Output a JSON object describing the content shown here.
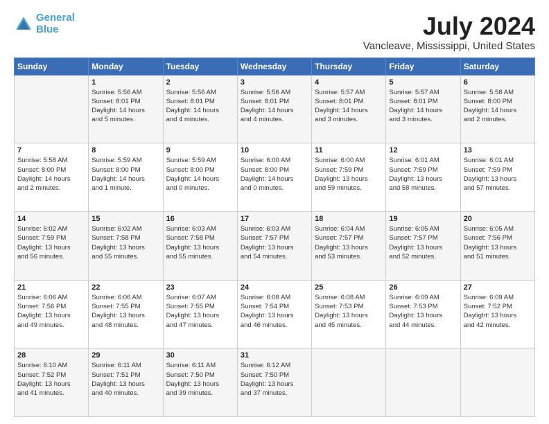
{
  "logo": {
    "line1": "General",
    "line2": "Blue"
  },
  "title": "July 2024",
  "subtitle": "Vancleave, Mississippi, United States",
  "days_of_week": [
    "Sunday",
    "Monday",
    "Tuesday",
    "Wednesday",
    "Thursday",
    "Friday",
    "Saturday"
  ],
  "weeks": [
    [
      {
        "day": "",
        "info": ""
      },
      {
        "day": "1",
        "info": "Sunrise: 5:56 AM\nSunset: 8:01 PM\nDaylight: 14 hours\nand 5 minutes."
      },
      {
        "day": "2",
        "info": "Sunrise: 5:56 AM\nSunset: 8:01 PM\nDaylight: 14 hours\nand 4 minutes."
      },
      {
        "day": "3",
        "info": "Sunrise: 5:56 AM\nSunset: 8:01 PM\nDaylight: 14 hours\nand 4 minutes."
      },
      {
        "day": "4",
        "info": "Sunrise: 5:57 AM\nSunset: 8:01 PM\nDaylight: 14 hours\nand 3 minutes."
      },
      {
        "day": "5",
        "info": "Sunrise: 5:57 AM\nSunset: 8:01 PM\nDaylight: 14 hours\nand 3 minutes."
      },
      {
        "day": "6",
        "info": "Sunrise: 5:58 AM\nSunset: 8:00 PM\nDaylight: 14 hours\nand 2 minutes."
      }
    ],
    [
      {
        "day": "7",
        "info": "Sunrise: 5:58 AM\nSunset: 8:00 PM\nDaylight: 14 hours\nand 2 minutes."
      },
      {
        "day": "8",
        "info": "Sunrise: 5:59 AM\nSunset: 8:00 PM\nDaylight: 14 hours\nand 1 minute."
      },
      {
        "day": "9",
        "info": "Sunrise: 5:59 AM\nSunset: 8:00 PM\nDaylight: 14 hours\nand 0 minutes."
      },
      {
        "day": "10",
        "info": "Sunrise: 6:00 AM\nSunset: 8:00 PM\nDaylight: 14 hours\nand 0 minutes."
      },
      {
        "day": "11",
        "info": "Sunrise: 6:00 AM\nSunset: 7:59 PM\nDaylight: 13 hours\nand 59 minutes."
      },
      {
        "day": "12",
        "info": "Sunrise: 6:01 AM\nSunset: 7:59 PM\nDaylight: 13 hours\nand 58 minutes."
      },
      {
        "day": "13",
        "info": "Sunrise: 6:01 AM\nSunset: 7:59 PM\nDaylight: 13 hours\nand 57 minutes."
      }
    ],
    [
      {
        "day": "14",
        "info": "Sunrise: 6:02 AM\nSunset: 7:59 PM\nDaylight: 13 hours\nand 56 minutes."
      },
      {
        "day": "15",
        "info": "Sunrise: 6:02 AM\nSunset: 7:58 PM\nDaylight: 13 hours\nand 55 minutes."
      },
      {
        "day": "16",
        "info": "Sunrise: 6:03 AM\nSunset: 7:58 PM\nDaylight: 13 hours\nand 55 minutes."
      },
      {
        "day": "17",
        "info": "Sunrise: 6:03 AM\nSunset: 7:57 PM\nDaylight: 13 hours\nand 54 minutes."
      },
      {
        "day": "18",
        "info": "Sunrise: 6:04 AM\nSunset: 7:57 PM\nDaylight: 13 hours\nand 53 minutes."
      },
      {
        "day": "19",
        "info": "Sunrise: 6:05 AM\nSunset: 7:57 PM\nDaylight: 13 hours\nand 52 minutes."
      },
      {
        "day": "20",
        "info": "Sunrise: 6:05 AM\nSunset: 7:56 PM\nDaylight: 13 hours\nand 51 minutes."
      }
    ],
    [
      {
        "day": "21",
        "info": "Sunrise: 6:06 AM\nSunset: 7:56 PM\nDaylight: 13 hours\nand 49 minutes."
      },
      {
        "day": "22",
        "info": "Sunrise: 6:06 AM\nSunset: 7:55 PM\nDaylight: 13 hours\nand 48 minutes."
      },
      {
        "day": "23",
        "info": "Sunrise: 6:07 AM\nSunset: 7:55 PM\nDaylight: 13 hours\nand 47 minutes."
      },
      {
        "day": "24",
        "info": "Sunrise: 6:08 AM\nSunset: 7:54 PM\nDaylight: 13 hours\nand 46 minutes."
      },
      {
        "day": "25",
        "info": "Sunrise: 6:08 AM\nSunset: 7:53 PM\nDaylight: 13 hours\nand 45 minutes."
      },
      {
        "day": "26",
        "info": "Sunrise: 6:09 AM\nSunset: 7:53 PM\nDaylight: 13 hours\nand 44 minutes."
      },
      {
        "day": "27",
        "info": "Sunrise: 6:09 AM\nSunset: 7:52 PM\nDaylight: 13 hours\nand 42 minutes."
      }
    ],
    [
      {
        "day": "28",
        "info": "Sunrise: 6:10 AM\nSunset: 7:52 PM\nDaylight: 13 hours\nand 41 minutes."
      },
      {
        "day": "29",
        "info": "Sunrise: 6:11 AM\nSunset: 7:51 PM\nDaylight: 13 hours\nand 40 minutes."
      },
      {
        "day": "30",
        "info": "Sunrise: 6:11 AM\nSunset: 7:50 PM\nDaylight: 13 hours\nand 39 minutes."
      },
      {
        "day": "31",
        "info": "Sunrise: 6:12 AM\nSunset: 7:50 PM\nDaylight: 13 hours\nand 37 minutes."
      },
      {
        "day": "",
        "info": ""
      },
      {
        "day": "",
        "info": ""
      },
      {
        "day": "",
        "info": ""
      }
    ]
  ]
}
